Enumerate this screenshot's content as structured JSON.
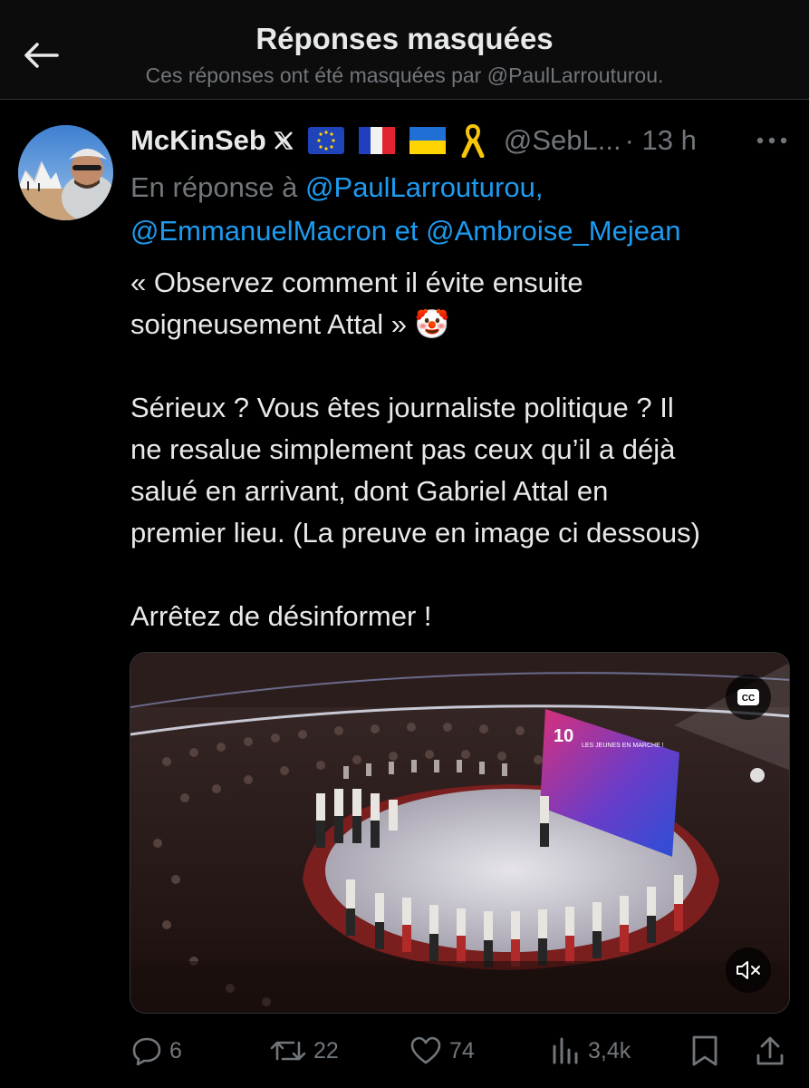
{
  "header": {
    "title": "Réponses masquées",
    "subtitle": "Ces réponses ont été masquées par @PaulLarrouturou."
  },
  "tweet": {
    "display_name": "McKinSeb",
    "badges": [
      "x-logo-icon",
      "eu-flag-icon",
      "france-flag-icon",
      "ukraine-flag-icon",
      "yellow-ribbon-icon"
    ],
    "handle": "@SebL...",
    "time": "· 13 h",
    "reply_prefix": "En réponse à",
    "reply_mention_1": "@PaulLarrouturou,",
    "reply_mention_2": "@EmmanuelMacron",
    "reply_joiner": "et",
    "reply_mention_3": "@Ambroise_Mejean",
    "text_line_1": "« Observez comment il évite ensuite",
    "text_line_2": "soigneusement Attal »",
    "text_emoji": "🤡",
    "paragraph_2_line_1": "Sérieux ? Vous êtes journaliste politique ? Il",
    "paragraph_2_line_2": "ne resalue simplement pas ceux qu’il a déjà",
    "paragraph_2_line_3": "salué en arrivant, dont Gabriel Attal en",
    "paragraph_2_line_4": "premier lieu. (La preuve en image ci dessous)",
    "paragraph_3": "Arrêtez de désinformer !"
  },
  "media": {
    "type": "video",
    "cc_label": "CC",
    "screen_text": "LES JEUNES EN MARCHE !",
    "screen_number": "10"
  },
  "actions": {
    "replies": "6",
    "reposts": "22",
    "likes": "74",
    "views": "3,4k"
  },
  "colors": {
    "background": "#000000",
    "text": "#e7e9ea",
    "muted": "#71767b",
    "link": "#1d9bf0"
  }
}
